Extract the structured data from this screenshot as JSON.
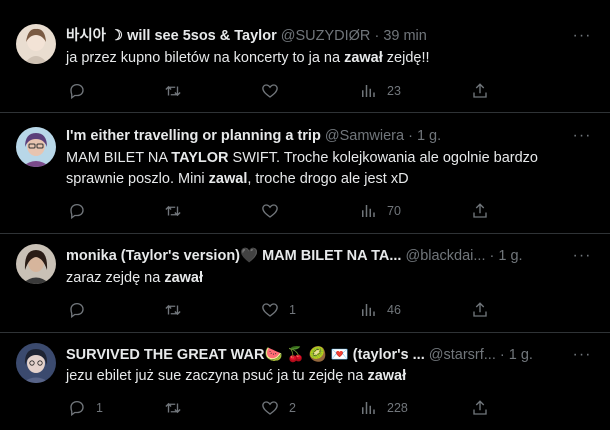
{
  "tweets": [
    {
      "name": "바시아 ☽ will see 5sos & Taylor",
      "handle": "@SUZYDIØR",
      "dot": "·",
      "time": "39 min",
      "text_parts": [
        "ja przez kupno biletów na koncerty to ja na ",
        "zawał",
        " zejdę!!"
      ],
      "replies": "",
      "retweets": "",
      "likes": "",
      "views": "23"
    },
    {
      "name": "I'm either travelling or planning a trip",
      "handle": "@Samwiera",
      "dot": "·",
      "time": "1 g.",
      "text_parts": [
        "MAM BILET NA ",
        "TAYLOR",
        " SWIFT. Troche kolejkowania ale ogolnie bardzo sprawnie poszlo. Mini ",
        "zawal",
        ", troche drogo ale jest xD"
      ],
      "replies": "",
      "retweets": "",
      "likes": "",
      "views": "70"
    },
    {
      "name": "monika (Taylor's version)🖤 MAM BILET NA TA...",
      "handle": "@blackdai...",
      "dot": "·",
      "time": "1 g.",
      "text_parts": [
        "zaraz zejdę na ",
        "zawał"
      ],
      "replies": "",
      "retweets": "",
      "likes": "1",
      "views": "46"
    },
    {
      "name": "SURVIVED THE GREAT WAR🍉 🍒 🥝 💌 (taylor's ...",
      "handle": "@starsrf...",
      "dot": "·",
      "time": "1 g.",
      "text_parts": [
        "jezu ebilet już sue zaczyna psuć ja tu zejdę na ",
        "zawał"
      ],
      "replies": "1",
      "retweets": "",
      "likes": "2",
      "views": "228"
    }
  ],
  "icons": {
    "reply": "reply-icon",
    "retweet": "retweet-icon",
    "like": "heart-icon",
    "views": "views-icon",
    "share": "share-icon",
    "more": "more-icon"
  },
  "colors": {
    "background": "#000000",
    "text": "#e7e9ea",
    "muted": "#71767b",
    "divider": "#2f3336"
  }
}
